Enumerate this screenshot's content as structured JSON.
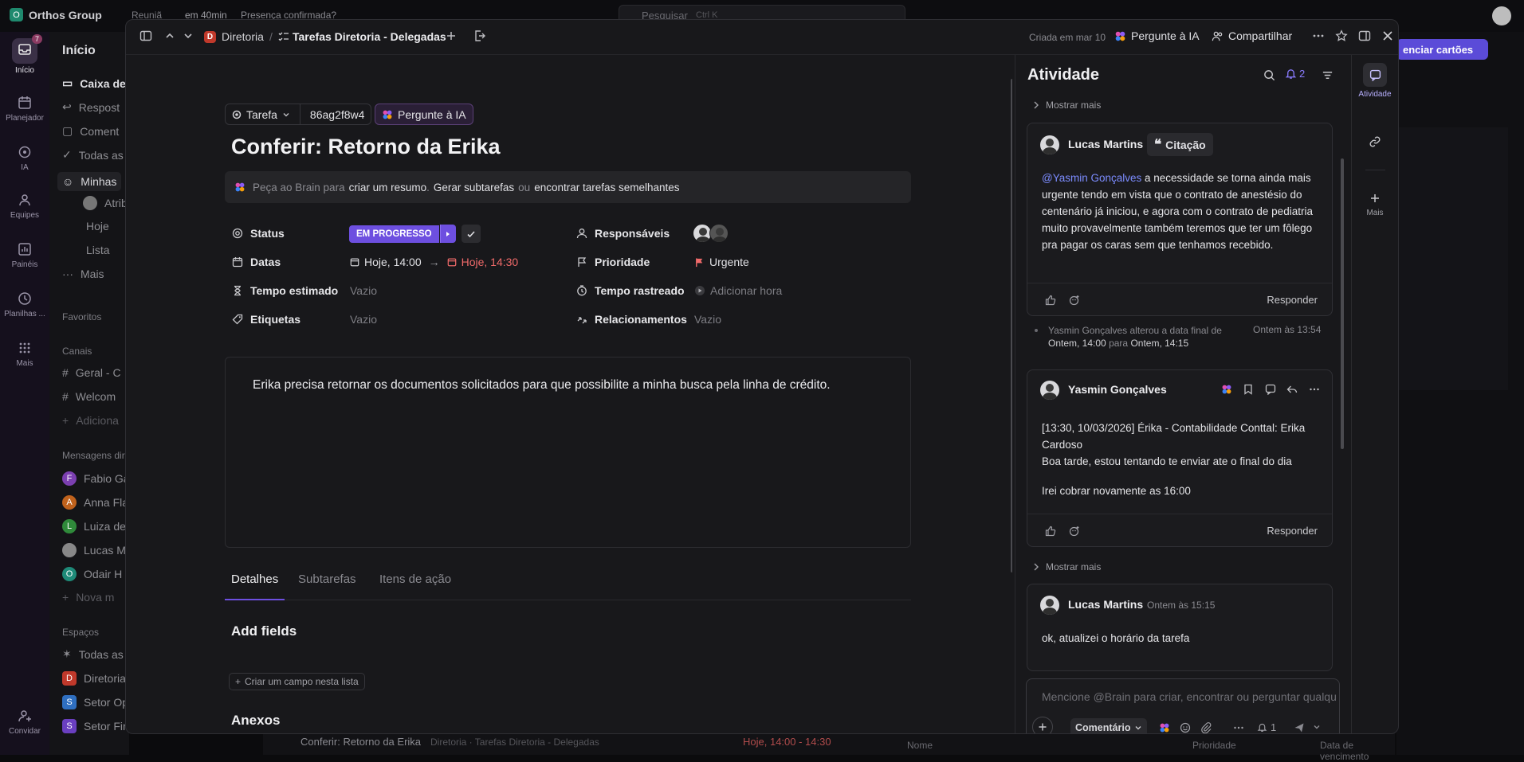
{
  "topbar": {
    "workspace": "Orthos Group",
    "workspace_initial": "O",
    "meeting": "Reuniã",
    "meeting_time": "em 40min",
    "meeting_status": "Presença confirmada?",
    "search_placeholder": "Pesquisar",
    "search_shortcut": "Ctrl K"
  },
  "rail": {
    "inbox_badge": "7",
    "items": [
      {
        "label": "Início"
      },
      {
        "label": "Planejador"
      },
      {
        "label": "IA"
      },
      {
        "label": "Equipes"
      },
      {
        "label": "Painéis"
      },
      {
        "label": "Planilhas ..."
      },
      {
        "label": "Mais"
      },
      {
        "label": "Convidar"
      }
    ]
  },
  "leftnav": {
    "title": "Início",
    "items": [
      "Caixa de",
      "Respost",
      "Coment",
      "Todas as",
      "Minhas",
      "Atrib",
      "Hoje",
      "Lista",
      "Mais"
    ],
    "favorites": "Favoritos",
    "channels_title": "Canais",
    "channels": [
      "Geral - C",
      "Welcom",
      "Adiciona"
    ],
    "dm_title": "Mensagens dir",
    "dms": [
      {
        "initial": "F",
        "name": "Fabio Ga",
        "color": "#7b3fb0"
      },
      {
        "initial": "A",
        "name": "Anna Fla",
        "color": "#c0621c"
      },
      {
        "initial": "L",
        "name": "Luiza de",
        "color": "#2f8a3a"
      },
      {
        "initial": "",
        "name": "Lucas M",
        "color": "#888"
      },
      {
        "initial": "O",
        "name": "Odair H",
        "color": "#1e8a78"
      }
    ],
    "dm_new": "Nova m",
    "spaces_title": "Espaços",
    "spaces": [
      {
        "initial": "",
        "name": "Todas as",
        "color": ""
      },
      {
        "initial": "D",
        "name": "Diretoria",
        "color": "#c0392b"
      },
      {
        "initial": "S",
        "name": "Setor Op",
        "color": "#2f6fc0"
      },
      {
        "initial": "S",
        "name": "Setor Fin",
        "color": "#6a3fc0"
      }
    ]
  },
  "background": {
    "manage_cards": "enciar cartões",
    "bottom_task": "Conferir: Retorno da Erika",
    "bottom_crumb": "Diretoria · Tarefas Diretoria - Delegadas",
    "bottom_date": "Hoje, 14:00 - 14:30",
    "col_name": "Nome",
    "col_priority": "Prioridade",
    "col_due": "Data de vencimento"
  },
  "header": {
    "space_initial": "D",
    "space": "Diretoria",
    "separator": "/",
    "list": "Tarefas Diretoria - Delegadas",
    "created": "Criada em mar 10",
    "ask_ai": "Pergunte à IA",
    "share": "Compartilhar"
  },
  "task": {
    "type": "Tarefa",
    "id": "86ag2f8w4",
    "ask_ai": "Pergunte à IA",
    "title": "Conferir: Retorno da Erika",
    "brain_prefix": "Peça ao Brain para",
    "brain_link1": "criar um resumo",
    "brain_sep1": ".",
    "brain_link2": "Gerar subtarefas",
    "brain_or": "ou",
    "brain_link3": "encontrar tarefas semelhantes",
    "props": {
      "status_label": "Status",
      "status_value": "EM PROGRESSO",
      "dates_label": "Datas",
      "date_start": "Hoje, 14:00",
      "date_arrow": "→",
      "date_end": "Hoje, 14:30",
      "estimate_label": "Tempo estimado",
      "estimate_value": "Vazio",
      "tags_label": "Etiquetas",
      "tags_value": "Vazio",
      "assignees_label": "Responsáveis",
      "priority_label": "Prioridade",
      "priority_value": "Urgente",
      "tracked_label": "Tempo rastreado",
      "tracked_value": "Adicionar hora",
      "relations_label": "Relacionamentos",
      "relations_value": "Vazio"
    },
    "description": "Erika precisa retornar os documentos solicitados para que possibilite a minha busca pela linha de crédito.",
    "tabs": [
      "Detalhes",
      "Subtarefas",
      "Itens de ação"
    ],
    "add_fields": "Add fields",
    "create_field": "Criar um campo nesta lista",
    "attachments": "Anexos"
  },
  "activity": {
    "title": "Atividade",
    "notif_count": "2",
    "show_more": "Mostrar mais",
    "comment1": {
      "author": "Lucas Martins",
      "tag": "Citação",
      "mention": "@Yasmin Gonçalves",
      "text": " a necessidade se torna ainda mais urgente tendo em vista que o contrato de anestésio do centenário já iniciou, e agora com o contrato de pediatria muito provavelmente também teremos que ter um fôlego pra pagar os caras sem que tenhamos recebido.",
      "reply": "Responder"
    },
    "event": {
      "text": "Yasmin Gonçalves alterou a data final de",
      "from": "Ontem, 14:00",
      "to_word": "para",
      "to": "Ontem, 14:15",
      "time": "Ontem às 13:54"
    },
    "comment2": {
      "author": "Yasmin Gonçalves",
      "line1": "[13:30, 10/03/2026] Érika - Contabilidade Conttal: Erika Cardoso",
      "line2": "Boa tarde, estou tentando te enviar ate o final do dia",
      "line3": "Irei cobrar novamente as 16:00",
      "reply": "Responder"
    },
    "show_more2": "Mostrar mais",
    "comment3": {
      "author": "Lucas Martins",
      "time": "Ontem às 15:15",
      "text": "ok, atualizei o horário da tarefa"
    },
    "input_placeholder": "Mencione @Brain para criar, encontrar ou perguntar qualquer coisa",
    "comment_type": "Comentário",
    "watchers": "1"
  },
  "side": {
    "activity": "Atividade",
    "more": "Mais"
  },
  "colors": {
    "accent": "#6d4fe0",
    "urgent": "#f06a6a",
    "mention": "#7c8cff"
  }
}
